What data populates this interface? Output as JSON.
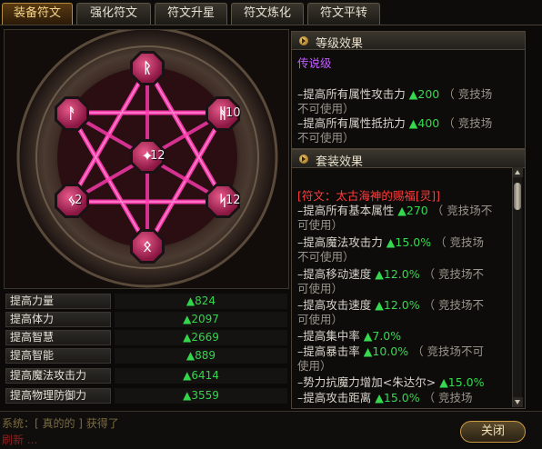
{
  "tabs": [
    {
      "label": "装备符文",
      "active": true
    },
    {
      "label": "强化符文",
      "active": false
    },
    {
      "label": "符文升星",
      "active": false
    },
    {
      "label": "符文炼化",
      "active": false
    },
    {
      "label": "符文平转",
      "active": false
    }
  ],
  "runes": {
    "top": {
      "glyph": "ᚱ",
      "level": ""
    },
    "upper_right": {
      "glyph": "ᚻ",
      "level": "10"
    },
    "center": {
      "glyph": "✦",
      "level": "12"
    },
    "lower_right": {
      "glyph": "ᛋ",
      "level": "12"
    },
    "bottom": {
      "glyph": "ᛟ",
      "level": ""
    },
    "lower_left": {
      "glyph": "ᛃ",
      "level": "2"
    },
    "upper_left": {
      "glyph": "ᚨ",
      "level": ""
    }
  },
  "stats": [
    {
      "label": "提高力量",
      "value": "▲824"
    },
    {
      "label": "提高体力",
      "value": "▲2097"
    },
    {
      "label": "提高智慧",
      "value": "▲2669"
    },
    {
      "label": "提高智能",
      "value": "▲889"
    },
    {
      "label": "提高魔法攻击力",
      "value": "▲6414"
    },
    {
      "label": "提高物理防御力",
      "value": "▲3559"
    }
  ],
  "level_effect": {
    "title": "等级效果",
    "grade": "传说级",
    "l1": "–提高所有属性攻击力",
    "v1": "▲200",
    "n1": "（ 竞技场",
    "n1b": "不可使用）",
    "l2": "–提高所有属性抵抗力",
    "v2": "▲400",
    "n2": "（ 竞技场",
    "n2b": "不可使用）"
  },
  "set_effect": {
    "title": "套装效果",
    "set_name": "[符文：太古海神的赐福[灵]]",
    "items": [
      {
        "label": "–提高所有基本属性",
        "value": "▲270",
        "note": "（ 竞技场不",
        "note2": "可使用）"
      },
      {
        "label": "–提高魔法攻击力",
        "value": "▲15.0%",
        "note": "（ 竞技场",
        "note2": "不可使用）"
      },
      {
        "label": "–提高移动速度",
        "value": "▲12.0%",
        "note": "（ 竞技场不",
        "note2": "可使用）"
      },
      {
        "label": "–提高攻击速度",
        "value": "▲12.0%",
        "note": "（ 竞技场不",
        "note2": "可使用）"
      },
      {
        "label": "–提高集中率",
        "value": "▲7.0%",
        "note": "",
        "note2": ""
      },
      {
        "label": "–提高暴击率",
        "value": "▲10.0%",
        "note": "（ 竞技场不可",
        "note2": "使用）"
      },
      {
        "label": "–势力抗魔力增加<朱达尔>",
        "value": "▲15.0%",
        "note": "",
        "note2": ""
      },
      {
        "label": "–提高攻击距离",
        "value": "▲15.0%",
        "note": "（ 竞技场",
        "note2": ""
      }
    ]
  },
  "chat": {
    "line1": "系统：[ 真的的 ] 获得了",
    "line2": "刷新 ..."
  },
  "close_label": "关闭"
}
